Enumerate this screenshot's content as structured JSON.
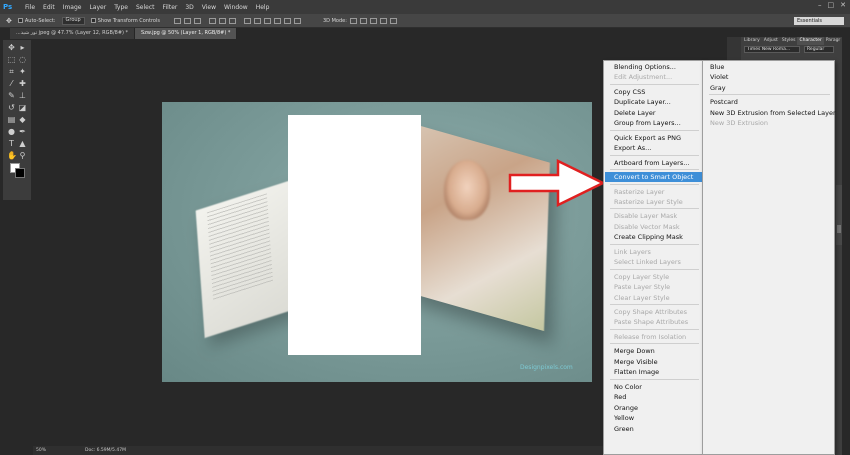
{
  "app": {
    "name": "Ps"
  },
  "menubar": [
    "File",
    "Edit",
    "Image",
    "Layer",
    "Type",
    "Select",
    "Filter",
    "3D",
    "View",
    "Window",
    "Help"
  ],
  "window_controls": [
    "–",
    "□",
    "✕"
  ],
  "options": {
    "auto_select_label": "Auto-Select:",
    "auto_select_value": "Group",
    "transform_controls_label": "Show Transform Controls",
    "mode_3d_label": "3D Mode:",
    "workspace": "Essentials"
  },
  "tabs": [
    {
      "label": "...تور شید jpeg @ 47.7% (Layer 12, RGB/8#) *",
      "active": false
    },
    {
      "label": "Szw.jpg @ 50% (Layer 1, RGB/8#) *",
      "active": true
    }
  ],
  "right_panel": {
    "tabs": [
      "Library",
      "Adjust",
      "Styles",
      "Character",
      "Paragr"
    ],
    "active_tab": "Character",
    "font_family": "Times New Roma...",
    "font_style": "Regular"
  },
  "status": {
    "zoom": "50%",
    "doc": "Doc: 6.59M/5.47M"
  },
  "canvas": {
    "watermark": "Designpixels.com"
  },
  "context_menu": {
    "items": [
      {
        "label": "Blending Options...",
        "enabled": true
      },
      {
        "label": "Edit Adjustment...",
        "enabled": false
      },
      {
        "sep": true
      },
      {
        "label": "Copy CSS",
        "enabled": true
      },
      {
        "label": "Duplicate Layer...",
        "enabled": true
      },
      {
        "label": "Delete Layer",
        "enabled": true
      },
      {
        "label": "Group from Layers...",
        "enabled": true
      },
      {
        "sep": true
      },
      {
        "label": "Quick Export as PNG",
        "enabled": true
      },
      {
        "label": "Export As...",
        "enabled": true
      },
      {
        "sep": true
      },
      {
        "label": "Artboard from Layers...",
        "enabled": true
      },
      {
        "sep": true
      },
      {
        "label": "Convert to Smart Object",
        "enabled": true,
        "highlighted": true
      },
      {
        "sep": true
      },
      {
        "label": "Rasterize Layer",
        "enabled": false
      },
      {
        "label": "Rasterize Layer Style",
        "enabled": false
      },
      {
        "sep": true
      },
      {
        "label": "Disable Layer Mask",
        "enabled": false
      },
      {
        "label": "Disable Vector Mask",
        "enabled": false
      },
      {
        "label": "Create Clipping Mask",
        "enabled": true
      },
      {
        "sep": true
      },
      {
        "label": "Link Layers",
        "enabled": false
      },
      {
        "label": "Select Linked Layers",
        "enabled": false
      },
      {
        "sep": true
      },
      {
        "label": "Copy Layer Style",
        "enabled": false
      },
      {
        "label": "Paste Layer Style",
        "enabled": false
      },
      {
        "label": "Clear Layer Style",
        "enabled": false
      },
      {
        "sep": true
      },
      {
        "label": "Copy Shape Attributes",
        "enabled": false
      },
      {
        "label": "Paste Shape Attributes",
        "enabled": false
      },
      {
        "sep": true
      },
      {
        "label": "Release from Isolation",
        "enabled": false
      },
      {
        "sep": true
      },
      {
        "label": "Merge Down",
        "enabled": true
      },
      {
        "label": "Merge Visible",
        "enabled": true
      },
      {
        "label": "Flatten Image",
        "enabled": true
      },
      {
        "sep": true
      },
      {
        "label": "No Color",
        "enabled": true
      },
      {
        "label": "Red",
        "enabled": true
      },
      {
        "label": "Orange",
        "enabled": true
      },
      {
        "label": "Yellow",
        "enabled": true
      },
      {
        "label": "Green",
        "enabled": true
      }
    ]
  },
  "sub_menu": {
    "items": [
      {
        "label": "Blue",
        "enabled": true
      },
      {
        "label": "Violet",
        "enabled": true
      },
      {
        "label": "Gray",
        "enabled": true
      },
      {
        "sep": true
      },
      {
        "label": "Postcard",
        "enabled": true
      },
      {
        "label": "New 3D Extrusion from Selected Layer",
        "enabled": true
      },
      {
        "label": "New 3D Extrusion",
        "enabled": false
      }
    ]
  },
  "colors": {
    "highlight": "#3e8fd8",
    "arrow": "#e02020",
    "ps_blue": "#31a8ff"
  }
}
